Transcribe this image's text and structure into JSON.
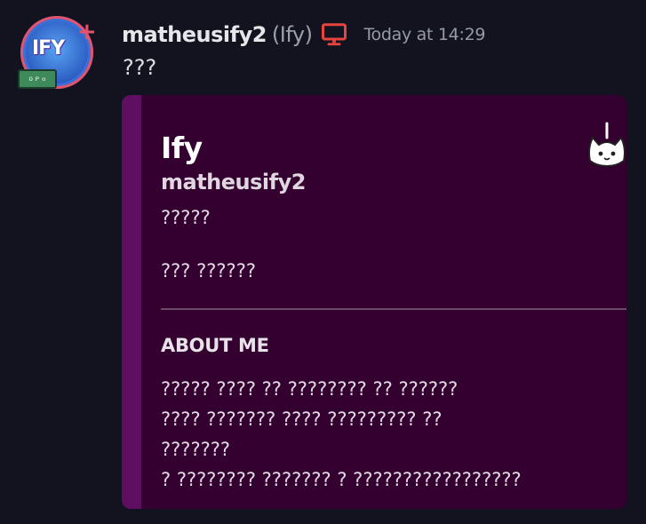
{
  "message": {
    "avatar": {
      "text": "IFY",
      "badge_text": "ᴼᴾᵒ",
      "plus": "+"
    },
    "author": {
      "username": "matheusify2",
      "nickname": "(Ify)",
      "device_icon": "desktop-icon",
      "timestamp": "Today at 14:29"
    },
    "content": "???",
    "embed": {
      "title": "Ify",
      "subtitle": "matheusify2",
      "line1": "?????",
      "line2": "??? ??????",
      "section_title": "ABOUT ME",
      "about_lines": [
        "????? ???? ?? ???????? ?? ??????",
        "???? ??????? ???? ????????? ??",
        "???????",
        "? ???????? ??????? ? ?????????????????"
      ],
      "thumbnail_icon": "cat-sticker-icon"
    }
  },
  "colors": {
    "background": "#13131f",
    "embed_accent": "#5f0f62",
    "embed_background": "#33002f",
    "device_icon": "#e8443f"
  }
}
